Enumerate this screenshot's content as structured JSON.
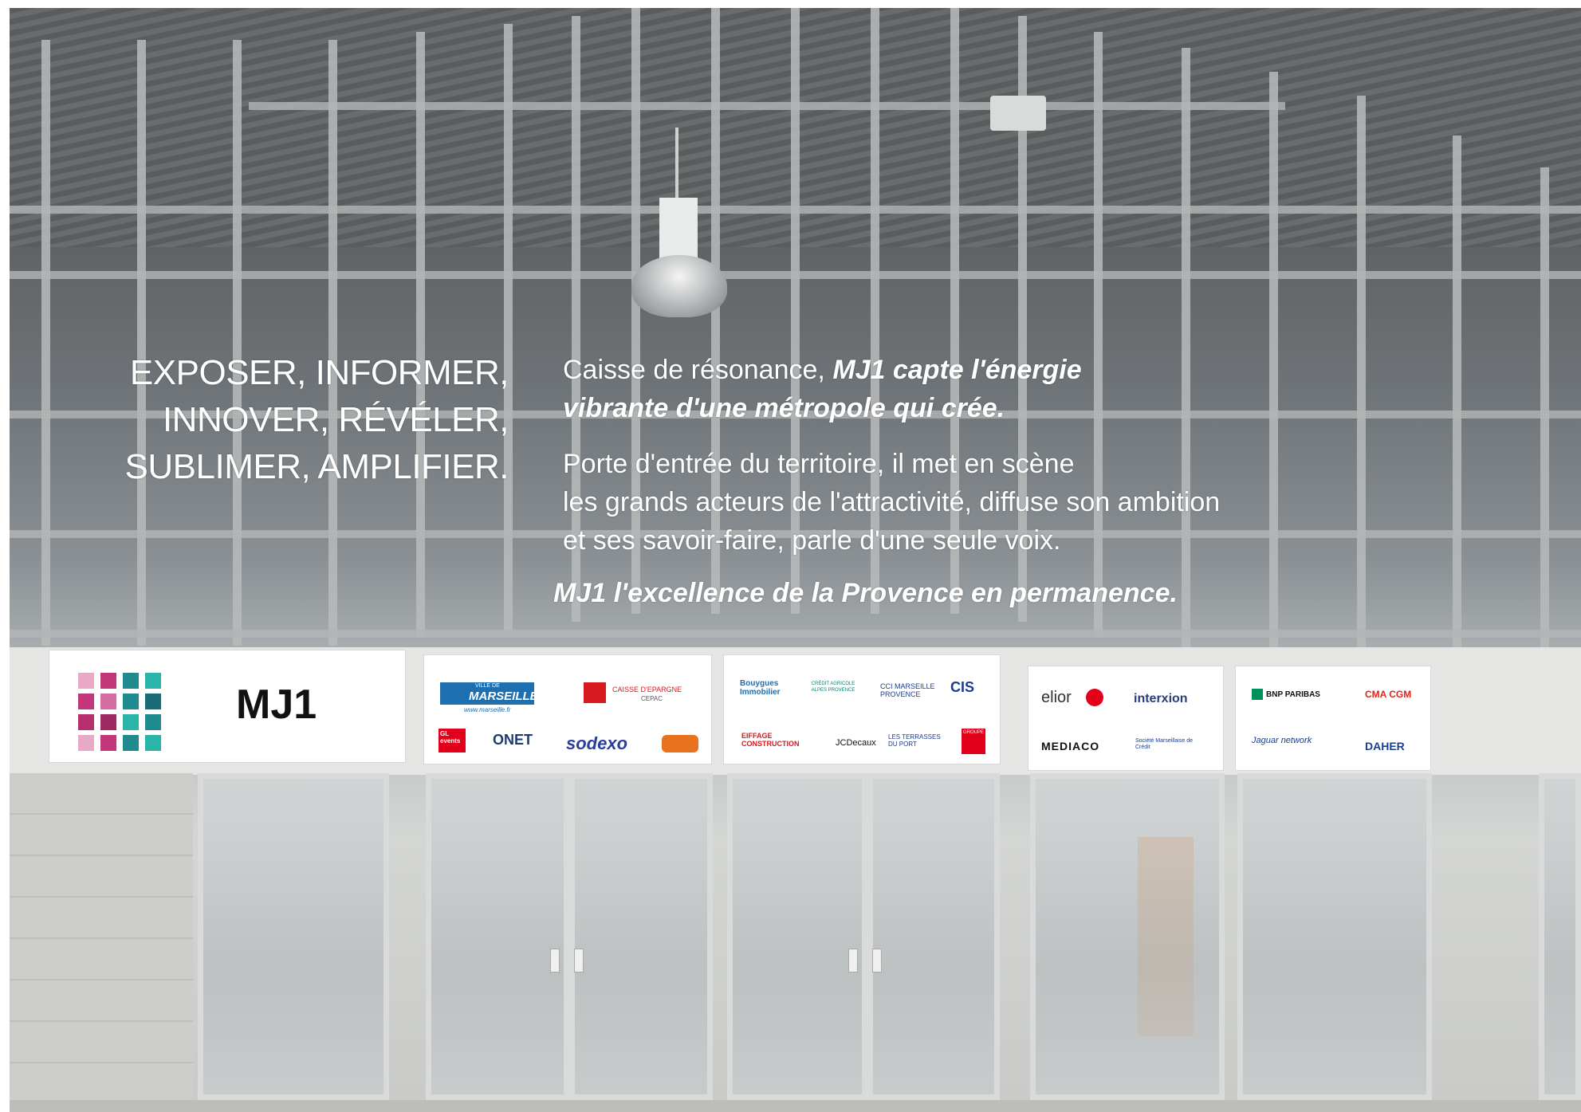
{
  "headline": {
    "line1": "EXPOSER, INFORMER,",
    "line2": "INNOVER, RÉVÉLER,",
    "line3": "SUBLIMER, AMPLIFIER."
  },
  "intro": {
    "plain": "Caisse de résonance, ",
    "bold1": "MJ1 capte l'énergie",
    "bold2": "vibrante d'une métropole qui crée."
  },
  "body": {
    "line1": "Porte d'entrée du territoire, il met en scène",
    "line2": "les grands acteurs de l'attractivité, diffuse son ambition",
    "line3": "et ses savoir-faire, parle d'une seule voix."
  },
  "tagline": "MJ1 l'excellence de la Provence en permanence.",
  "brand": {
    "name": "MJ1"
  },
  "sponsors": {
    "marseille": "MARSEILLE",
    "ville": "VILLE DE",
    "marseille_url": "www.marseille.fr",
    "caisse": "CAISSE D'EPARGNE",
    "cepac": "CEPAC",
    "gl": "GL events",
    "onet": "ONET",
    "sodexo": "sodexo",
    "bouygues": "Bouygues Immobilier",
    "credit_agricole": "CRÉDIT AGRICOLE ALPES PROVENCE",
    "cci": "CCI MARSEILLE PROVENCE",
    "cis": "CIS",
    "eiffage": "EIFFAGE CONSTRUCTION",
    "jcdecaux": "JCDecaux",
    "terrasses": "LES TERRASSES DU PORT",
    "groupe": "GROUPE",
    "elior": "elior",
    "interxion": "interxion",
    "mediaco": "MEDIACO",
    "smc": "Société Marseillaise de Crédit",
    "bnp": "BNP PARIBAS",
    "cmacgm": "CMA CGM",
    "jaguar": "Jaguar network",
    "daher": "DAHER"
  },
  "colors": {
    "mj1_magenta": "#c2377a",
    "mj1_teal": "#1f8b8f",
    "marseille_blue": "#1d6fb0",
    "caisse_red": "#d71920",
    "sodexo_blue": "#2a3d9a",
    "elior_red": "#e2001a",
    "bnp_green": "#00915a",
    "cma_red": "#e2231a",
    "daher_blue": "#1b3f8f"
  }
}
